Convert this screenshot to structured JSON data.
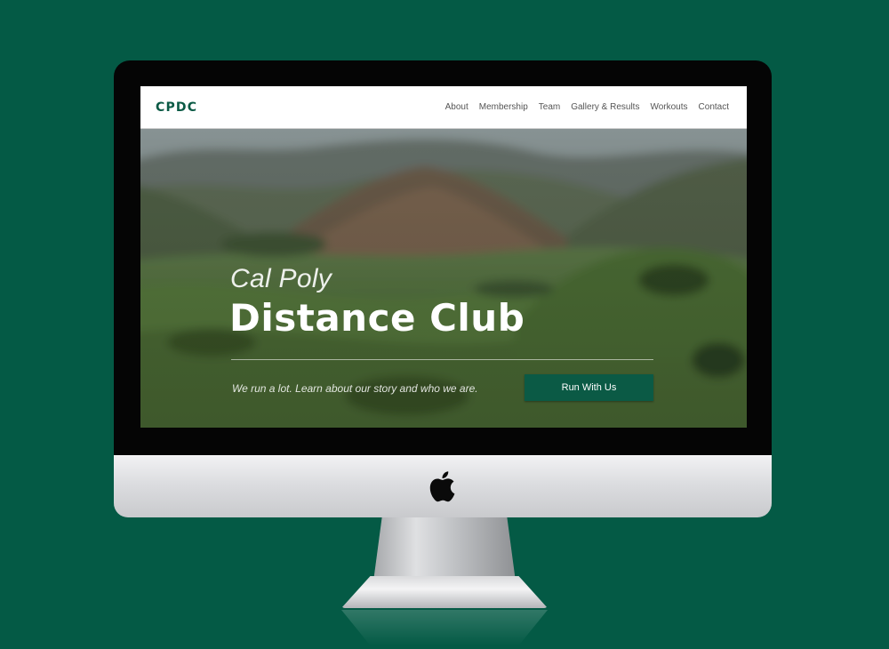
{
  "site": {
    "logo": "CPDC",
    "nav": [
      {
        "label": "About"
      },
      {
        "label": "Membership"
      },
      {
        "label": "Team"
      },
      {
        "label": "Gallery & Results"
      },
      {
        "label": "Workouts"
      },
      {
        "label": "Contact"
      }
    ]
  },
  "hero": {
    "subtitle": "Cal Poly",
    "title": "Distance Club",
    "tagline": "We run a lot. Learn about our story and who we are.",
    "cta_label": "Run With Us"
  },
  "colors": {
    "page_background": "#045a45",
    "brand_green": "#0b5a45",
    "nav_background": "#ffffff",
    "nav_text": "#555555"
  },
  "icons": {
    "device_logo": "apple-logo-icon"
  }
}
